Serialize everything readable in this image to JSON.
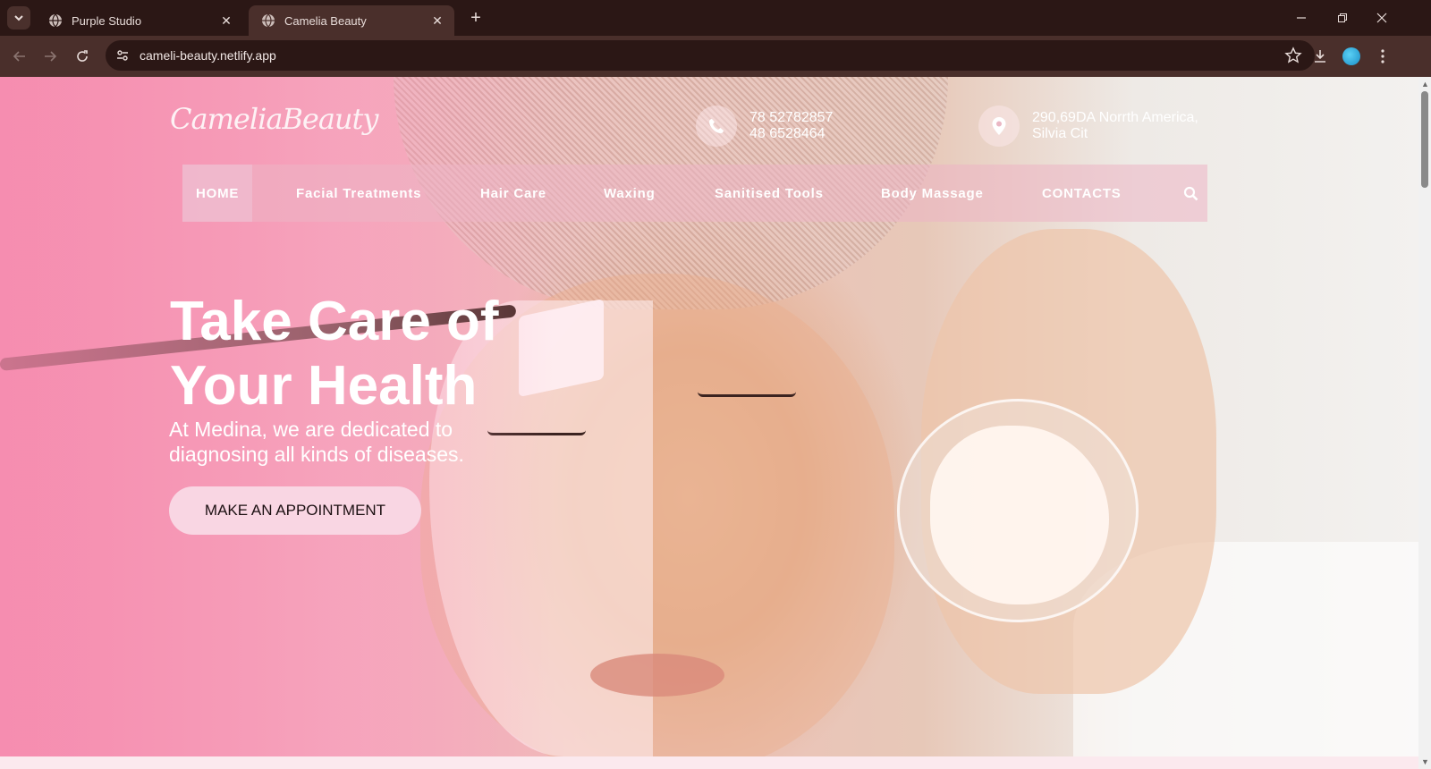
{
  "browser": {
    "tabs": [
      {
        "title": "Purple Studio",
        "active": false
      },
      {
        "title": "Camelia Beauty",
        "active": true
      }
    ],
    "url": "cameli-beauty.netlify.app"
  },
  "site": {
    "logo": "CameliaBeauty",
    "contacts": {
      "phone_line1": "78 52782857",
      "phone_line2": "48 6528464",
      "address_line1": "290,69DA Norrth America,",
      "address_line2": "Silvia Cit"
    },
    "nav": {
      "items": [
        {
          "label": "HOME",
          "active": true
        },
        {
          "label": "Facial Treatments",
          "active": false
        },
        {
          "label": "Hair Care",
          "active": false
        },
        {
          "label": "Waxing",
          "active": false
        },
        {
          "label": "Sanitised Tools",
          "active": false
        },
        {
          "label": "Body Massage",
          "active": false
        },
        {
          "label": "CONTACTS",
          "active": false
        }
      ]
    },
    "hero": {
      "title_line1": "Take Care of",
      "title_line2": "Your Health",
      "subtitle_line1": "At Medina, we are dedicated to",
      "subtitle_line2": "diagnosing all kinds of diseases.",
      "cta": "MAKE AN APPOINTMENT"
    }
  },
  "colors": {
    "chrome_dark": "#2b1715",
    "chrome_toolbar": "#4a2f2b",
    "hero_pink": "#f48fb1",
    "cta_bg": "#f9d6e3"
  }
}
